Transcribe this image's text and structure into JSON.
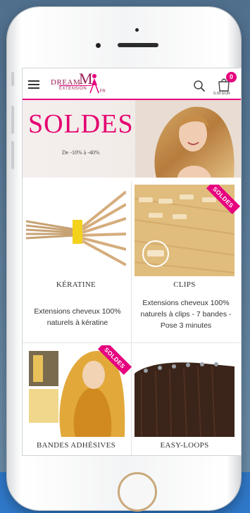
{
  "header": {
    "logo_dream": "DREAM",
    "logo_m": "M",
    "logo_extension": "EXTENSION",
    "logo_fr": ".FR",
    "cart_count": "0",
    "cart_total": "0,00 EUR"
  },
  "banner": {
    "title": "SOLDES",
    "subtitle": "De -10% à -40%"
  },
  "products": [
    {
      "name": "KÉRATINE",
      "description": "Extensions cheveux 100% naturels à kératine",
      "badge": ""
    },
    {
      "name": "CLIPS",
      "description": "Extensions cheveux 100% naturels à clips - 7 bandes - Pose 3 minutes",
      "badge": "SOLDES"
    },
    {
      "name": "BANDES ADHÉSIVES",
      "description": "",
      "badge": "SOLDES"
    },
    {
      "name": "EASY-LOOPS",
      "description": "",
      "badge": ""
    }
  ],
  "colors": {
    "accent": "#e6007e",
    "brand": "#9a1d55",
    "background_blue": "#2f78c8"
  },
  "icons": [
    "menu-icon",
    "search-icon",
    "cart-icon"
  ]
}
